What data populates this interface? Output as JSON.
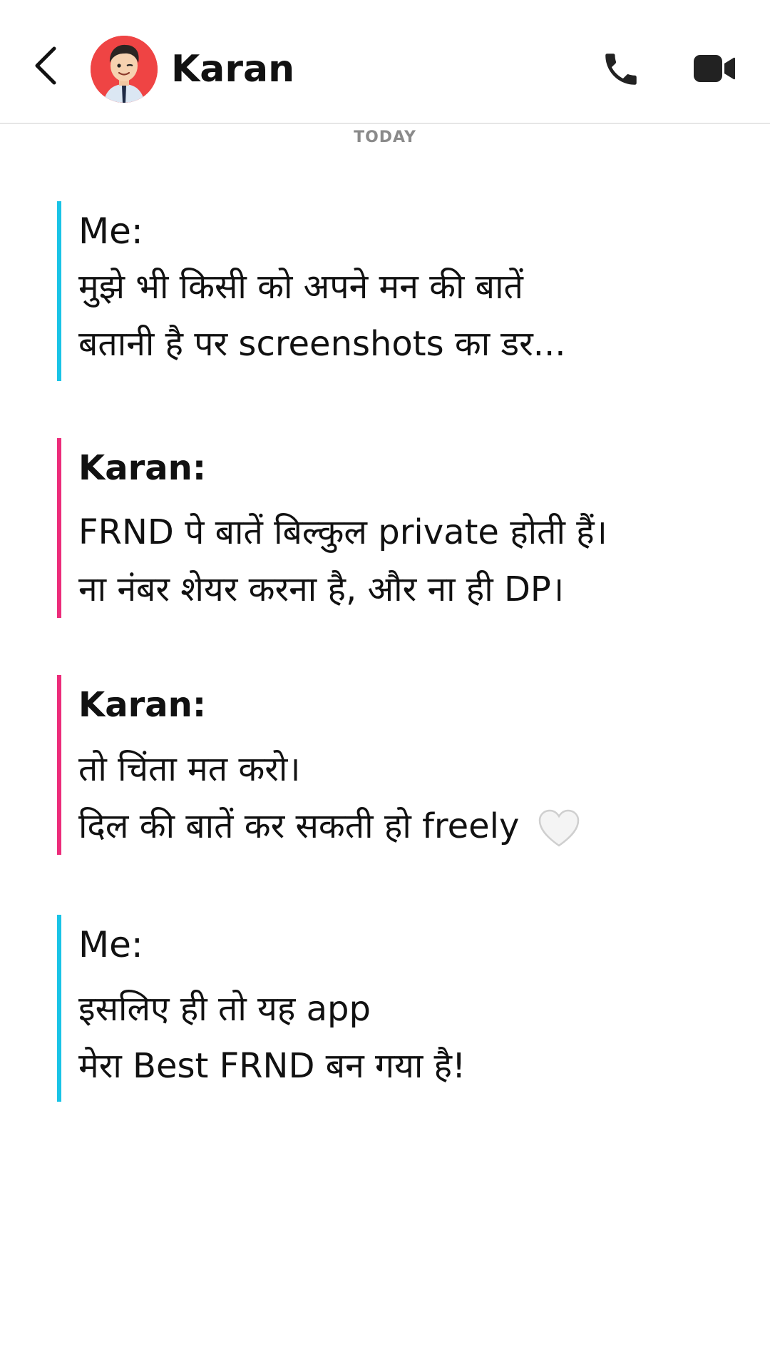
{
  "header": {
    "contact_name": "Karan",
    "back_icon": "chevron-left-icon",
    "call_icon": "phone-icon",
    "video_icon": "video-camera-icon"
  },
  "date_separator": "TODAY",
  "messages": [
    {
      "sender": "Me:",
      "lines": [
        "मुझे भी किसी को अपने मन की बातें",
        "बतानी है पर screenshots का डर..."
      ]
    },
    {
      "sender": "Karan:",
      "lines": [
        "FRND पे बातें बिल्कुल private होती हैं।",
        "ना नंबर शेयर करना है, और ना ही DP।"
      ]
    },
    {
      "sender": "Karan:",
      "lines": [
        "तो चिंता मत करो।",
        "दिल की बातें कर सकती हो freely"
      ],
      "emoji": "white-heart-icon"
    },
    {
      "sender": "Me:",
      "lines": [
        "इसलिए ही तो यह app",
        "मेरा Best FRND बन गया है!"
      ]
    }
  ],
  "colors": {
    "me_accent": "#19c3e6",
    "them_accent": "#ec2c7a",
    "avatar_bg": "#ef4444"
  }
}
